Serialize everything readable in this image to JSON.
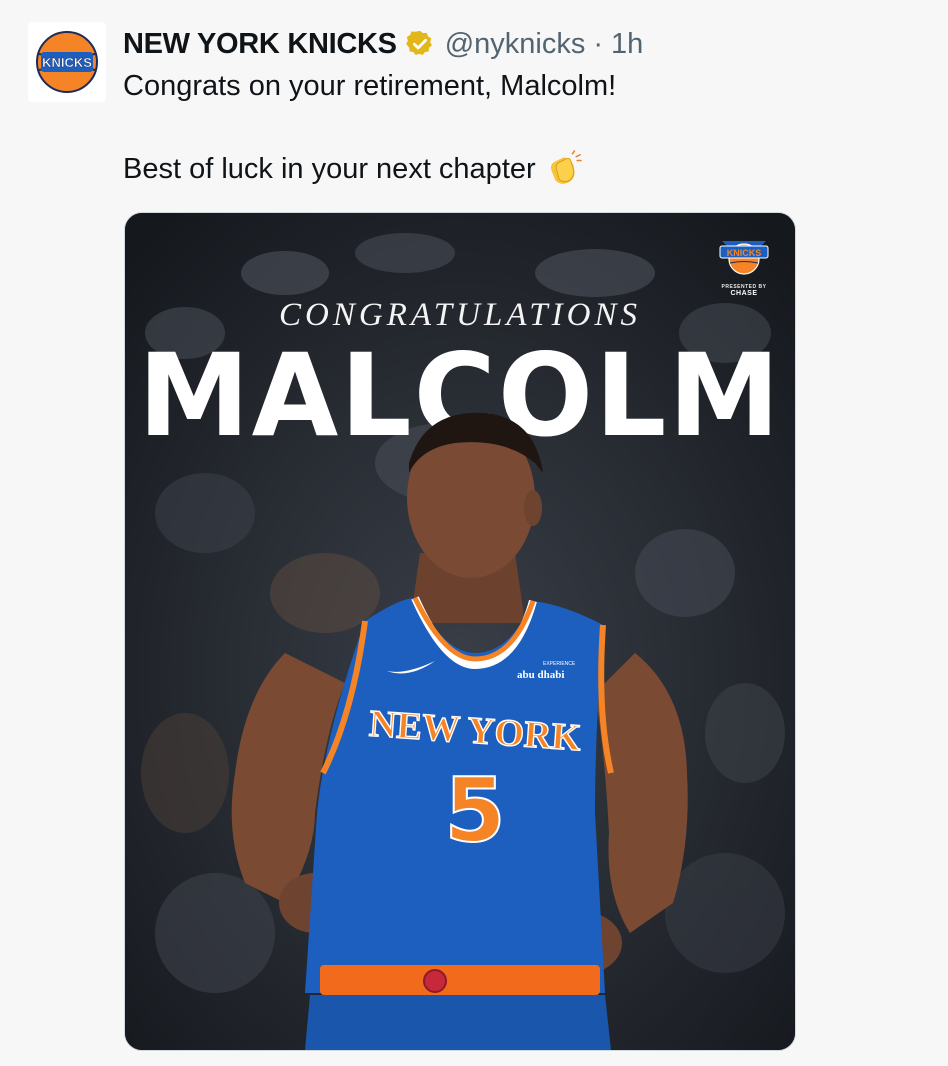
{
  "tweet": {
    "display_name": "NEW YORK KNICKS",
    "handle": "@nyknicks",
    "separator": "·",
    "time": "1h",
    "verified": true,
    "text_line1": "Congrats on your retirement, Malcolm!",
    "text_line2": "Best of luck in your next chapter",
    "emoji": "clapping-hands"
  },
  "avatar": {
    "logo_text": "KNICKS"
  },
  "media": {
    "headline_small": "CONGRATULATIONS",
    "headline_big": "MALCOLM",
    "corner_logo_text": "KNICKS",
    "presented_by": "PRESENTED BY",
    "sponsor": "CHASE",
    "jersey_city": "NEW YORK",
    "jersey_number": "5",
    "jersey_sponsor_small": "EXPERIENCE",
    "jersey_sponsor": "abu dhabi"
  },
  "colors": {
    "knicks_blue": "#1d5fbf",
    "knicks_orange": "#f58426",
    "verified_gold": "#e2b719",
    "text_primary": "#0f1419",
    "text_secondary": "#536471"
  }
}
